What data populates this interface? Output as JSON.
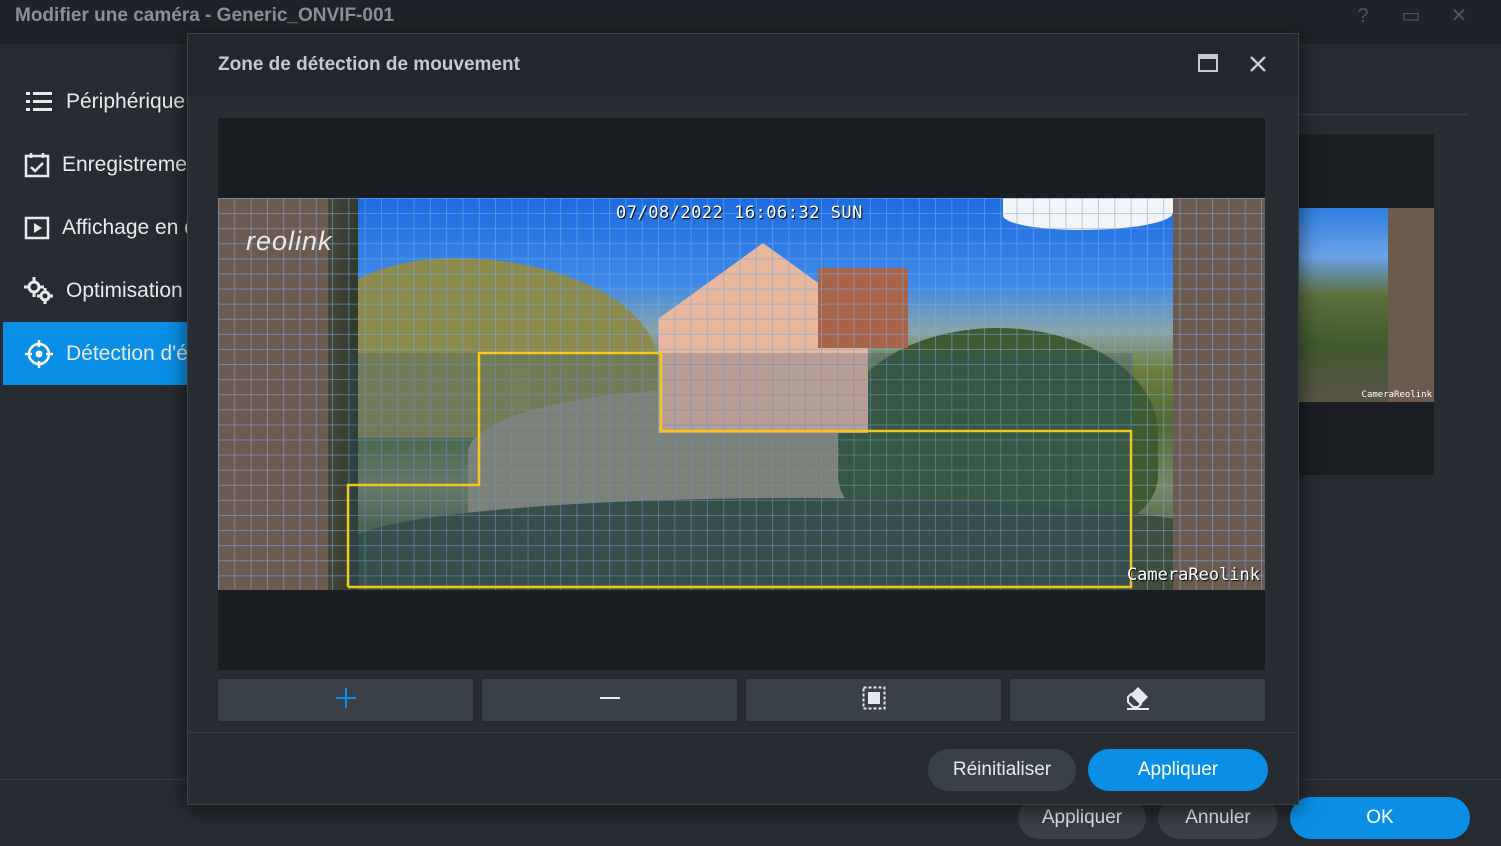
{
  "window": {
    "title": "Modifier une caméra - Generic_ONVIF-001",
    "controls": [
      "?",
      "▭",
      "✕"
    ]
  },
  "sidebar": {
    "items": [
      {
        "label": "Périphérique",
        "icon": "list-icon",
        "active": false
      },
      {
        "label": "Enregistrement",
        "icon": "calendar-check-icon",
        "active": false
      },
      {
        "label": "Affichage en direct",
        "icon": "play-square-icon",
        "active": false
      },
      {
        "label": "Optimisation",
        "icon": "gears-icon",
        "active": false
      },
      {
        "label": "Détection d'événements",
        "icon": "crosshair-icon",
        "active": true
      }
    ]
  },
  "main_preview": {
    "label": "CameraReolink"
  },
  "main_footer": {
    "apply": "Appliquer",
    "cancel": "Annuler",
    "ok": "OK"
  },
  "modal": {
    "title": "Zone de détection de mouvement",
    "camera": {
      "timestamp": "07/08/2022 16:06:32 SUN",
      "logo": "reolink",
      "label": "CameraReolink"
    },
    "tools": [
      {
        "name": "add",
        "icon": "plus-icon"
      },
      {
        "name": "remove",
        "icon": "minus-icon"
      },
      {
        "name": "select-all",
        "icon": "select-all-icon"
      },
      {
        "name": "erase",
        "icon": "eraser-icon"
      }
    ],
    "footer": {
      "reset": "Réinitialiser",
      "apply": "Appliquer"
    }
  },
  "colors": {
    "accent": "#0b8fe6",
    "zone_outline": "#f2c81e",
    "grid": "#78aae6"
  }
}
